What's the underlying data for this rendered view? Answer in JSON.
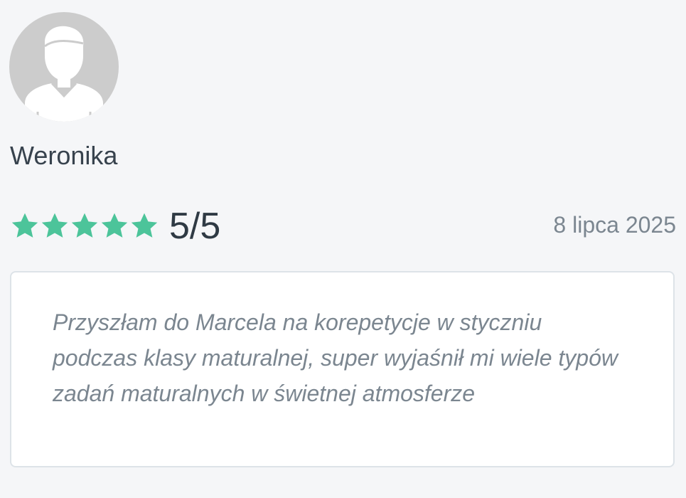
{
  "reviewer": {
    "avatar_icon": "user-avatar-icon",
    "name": "Weronika"
  },
  "rating": {
    "stars_filled": 5,
    "stars_total": 5,
    "star_icon": "star-icon",
    "star_color": "#4cc49a",
    "label": "5/5"
  },
  "review": {
    "date": "8 lipca 2025",
    "text": "Przyszłam do Marcela na korepetycje w styczniu podczas klasy maturalnej, super wyjaśnił mi wiele typów zadań maturalnych w świetnej atmosferze"
  },
  "colors": {
    "background": "#f5f6f8",
    "avatar_bg": "#cccccc",
    "avatar_fg": "#ffffff",
    "name_text": "#37424d",
    "muted_text": "#7b8690",
    "box_border": "#dde3e8"
  }
}
